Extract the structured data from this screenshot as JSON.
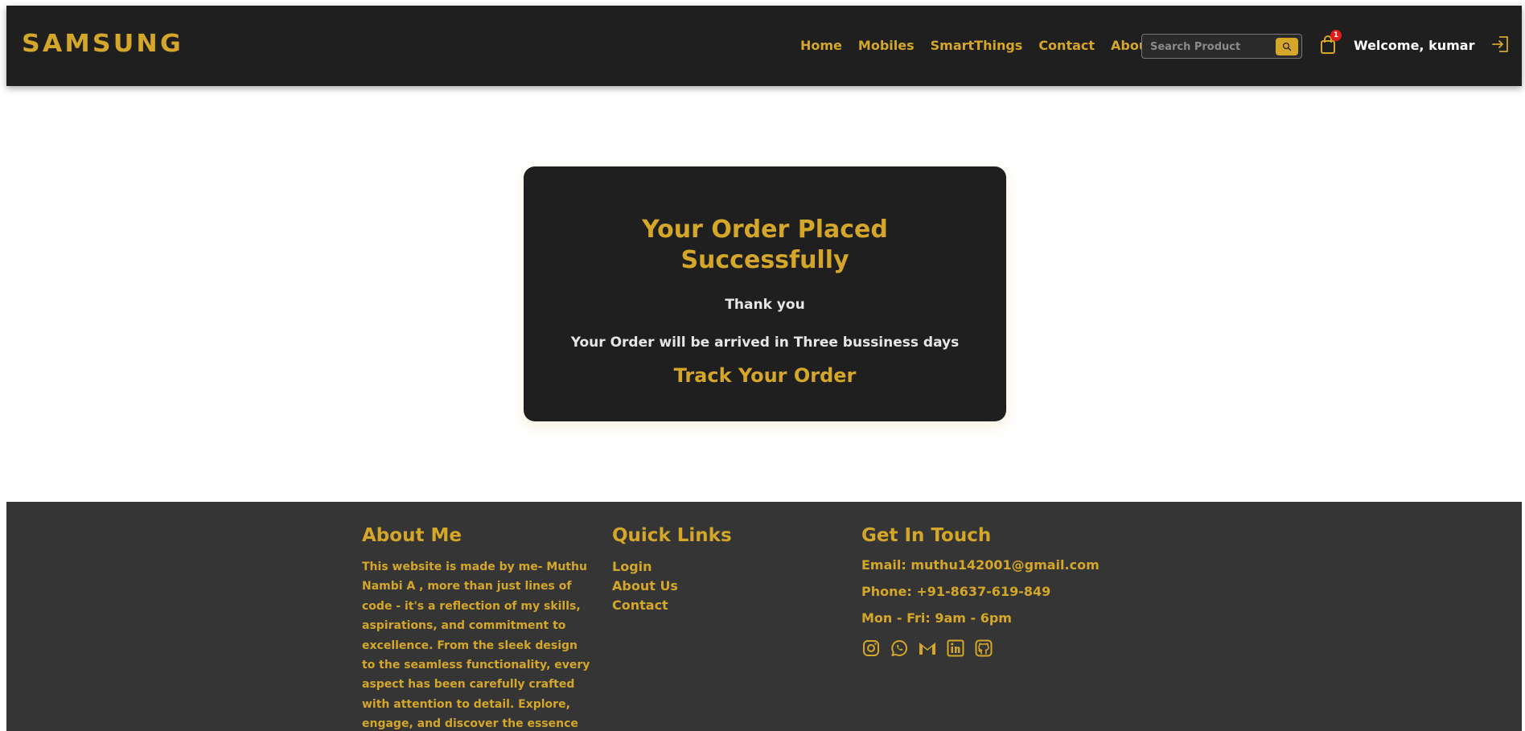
{
  "brand": {
    "logo_text": "SAMSUNG",
    "accent_color": "#d4a62a",
    "dark_bg": "#1f1f1f"
  },
  "navbar": {
    "links": [
      "Home",
      "Mobiles",
      "SmartThings",
      "Contact",
      "About"
    ],
    "search": {
      "placeholder": "Search Product",
      "value": "",
      "button_icon": "search-icon"
    },
    "cart": {
      "icon": "shopping-bag-icon",
      "count": "1"
    },
    "welcome_text": "Welcome, kumar",
    "logout_icon": "logout-icon"
  },
  "order": {
    "title": "Your Order Placed Successfully",
    "thanks": "Thank you",
    "message": "Your Order will be arrived in Three bussiness days",
    "track_label": "Track Your Order"
  },
  "footer": {
    "about": {
      "heading": "About Me",
      "text": "This website is made by me- Muthu Nambi A , more than just lines of code - it's a reflection of my skills, aspirations, and commitment to excellence. From the sleek design to the seamless functionality, every aspect has been carefully crafted with attention to detail. Explore, engage, and discover the essence"
    },
    "quick_links": {
      "heading": "Quick Links",
      "links": [
        "Login",
        "About Us",
        "Contact"
      ]
    },
    "contact": {
      "heading": "Get In Touch",
      "email": "Email: muthu142001@gmail.com",
      "phone": "Phone: +91-8637-619-849",
      "hours": "Mon - Fri: 9am - 6pm",
      "social_icons": [
        "instagram-icon",
        "whatsapp-icon",
        "gmail-icon",
        "linkedin-icon",
        "github-icon"
      ]
    }
  }
}
